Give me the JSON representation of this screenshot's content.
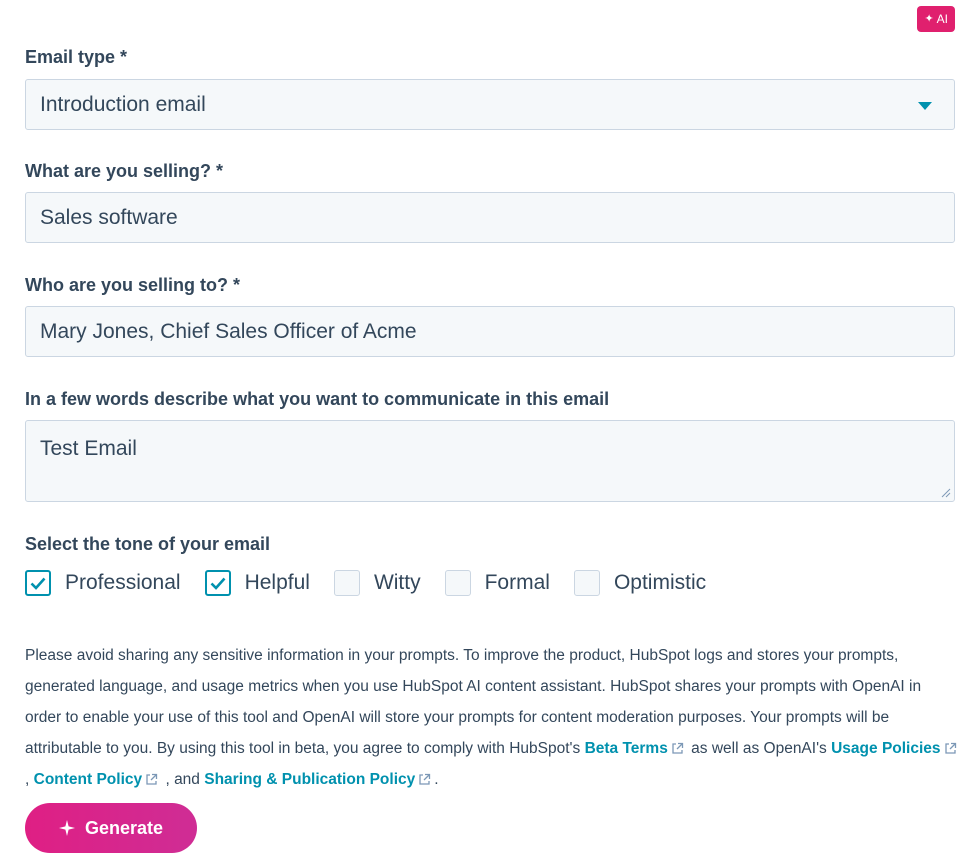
{
  "badge": {
    "label": "AI"
  },
  "email_type": {
    "label": "Email type *",
    "value": "Introduction email"
  },
  "selling_what": {
    "label": "What are you selling? *",
    "value": "Sales software"
  },
  "selling_to": {
    "label": "Who are you selling to? *",
    "value": "Mary Jones, Chief Sales Officer of Acme"
  },
  "communicate": {
    "label": "In a few words describe what you want to communicate in this email",
    "value": "Test Email"
  },
  "tone": {
    "label": "Select the tone of your email",
    "options": [
      {
        "label": "Professional",
        "checked": true
      },
      {
        "label": "Helpful",
        "checked": true
      },
      {
        "label": "Witty",
        "checked": false
      },
      {
        "label": "Formal",
        "checked": false
      },
      {
        "label": "Optimistic",
        "checked": false
      }
    ]
  },
  "disclaimer": {
    "part1": "Please avoid sharing any sensitive information in your prompts. To improve the product, HubSpot logs and stores your prompts, generated language, and usage metrics when you use HubSpot AI content assistant. HubSpot shares your prompts with OpenAI in order to enable your use of this tool and OpenAI will store your prompts for content moderation purposes. Your prompts will be attributable to you. By using this tool in beta, you agree to comply with HubSpot's",
    "link_beta_terms": "Beta Terms",
    "part2": "as well as OpenAI's",
    "link_usage_policies": "Usage Policies",
    "sep1": ",",
    "link_content_policy": "Content Policy",
    "part3": ", and",
    "link_sharing_policy": "Sharing & Publication Policy",
    "end": "."
  },
  "generate": {
    "label": "Generate"
  },
  "colors": {
    "accent_teal": "#0091ae",
    "brand_pink": "#e0206e",
    "text": "#33475b",
    "input_bg": "#f5f8fa",
    "input_border": "#cbd6e2"
  }
}
